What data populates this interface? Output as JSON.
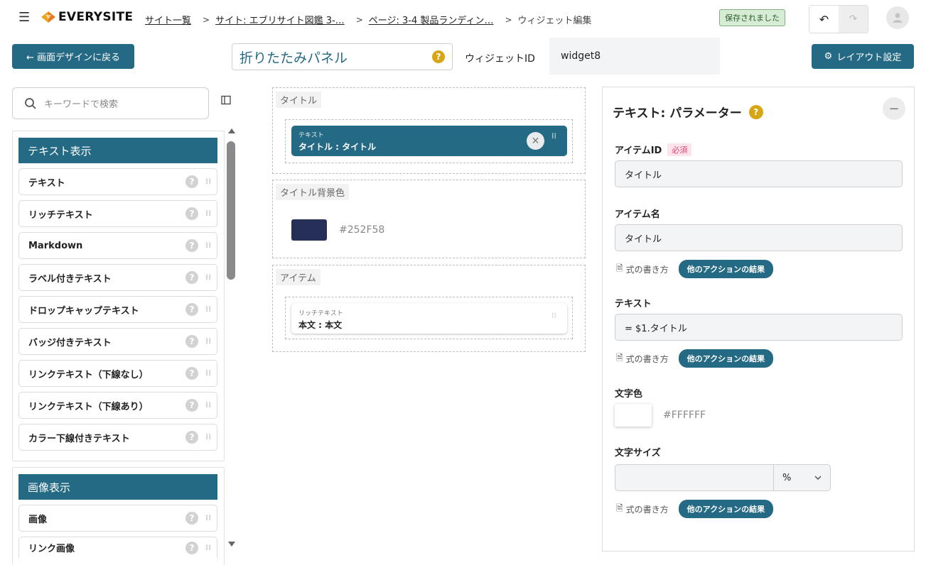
{
  "header": {
    "logo_text": "EVERYSITE",
    "breadcrumbs": [
      {
        "label": "サイト一覧",
        "link": true
      },
      {
        "label": "サイト: エブリサイト図鑑 3-…",
        "link": true
      },
      {
        "label": "ページ: 3-4 製品ランディン…",
        "link": true
      },
      {
        "label": "ウィジェット編集",
        "link": false
      }
    ],
    "separator": ">",
    "saved_status": "保存されました"
  },
  "toolbar": {
    "back_label": "← 画面デザインに戻る",
    "widget_name": "折りたたみパネル",
    "widget_id_label": "ウィジェットID",
    "widget_id_value": "widget8",
    "layout_label": "レイアウト設定"
  },
  "left_panel": {
    "search_placeholder": "キーワードで検索",
    "groups": [
      {
        "title": "テキスト表示",
        "items": [
          "テキスト",
          "リッチテキスト",
          "Markdown",
          "ラベル付きテキスト",
          "ドロップキャップテキスト",
          "バッジ付きテキスト",
          "リンクテキスト（下線なし）",
          "リンクテキスト（下線あり）",
          "カラー下線付きテキスト"
        ]
      },
      {
        "title": "画像表示",
        "items": [
          "画像",
          "リンク画像"
        ]
      }
    ]
  },
  "canvas": {
    "title_slot": {
      "label": "タイトル",
      "chip_type": "テキスト",
      "chip_text": "タイトル : タイトル"
    },
    "bg_slot": {
      "label": "タイトル背景色",
      "color": "#252F58",
      "color_text": "#252F58"
    },
    "items_slot": {
      "label": "アイテム",
      "chip_type": "リッチテキスト",
      "chip_text": "本文 : 本文"
    }
  },
  "right_panel": {
    "title": "テキスト: パラメーター",
    "item_id_label": "アイテムID",
    "required_badge": "必須",
    "item_id_value": "タイトル",
    "item_name_label": "アイテム名",
    "item_name_value": "タイトル",
    "formula_link": "式の書き方",
    "action_result": "他のアクションの結果",
    "text_label": "テキスト",
    "text_value": "= $1.タイトル",
    "text_color_label": "文字色",
    "text_color": "#FFFFFF",
    "text_color_text": "#FFFFFF",
    "font_size_label": "文字サイズ",
    "font_size_value": "",
    "font_size_unit": "%"
  },
  "colors": {
    "accent": "#256a84",
    "help_yellow": "#d7a614",
    "saved_bg": "#d6ecd4"
  }
}
